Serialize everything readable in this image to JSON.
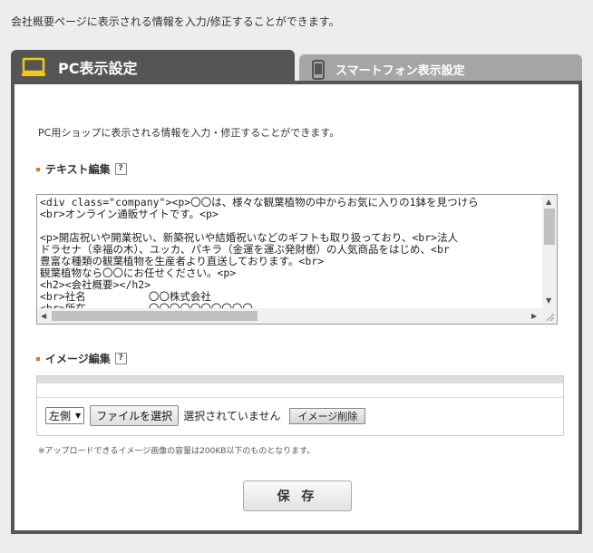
{
  "intro": "会社概要ページに表示される情報を入力/修正することができます。",
  "tabs": {
    "pc": {
      "label": "PC表示設定",
      "icon": "monitor-icon"
    },
    "smartphone": {
      "label": "スマートフォン表示設定",
      "icon": "smartphone-icon"
    }
  },
  "panel": {
    "description": "PC用ショップに表示される情報を入力・修正することができます。",
    "text_section": {
      "title": "テキスト編集",
      "help": "?"
    },
    "editor_content": "<div class=\"company\"><p>〇〇は、様々な観葉植物の中からお気に入りの1鉢を見つけら\n<br>オンライン通販サイトです。<p>\n\n<p>開店祝いや開業祝い、新築祝いや結婚祝いなどのギフトも取り扱っており、<br>法人\nドラセナ（幸福の木）、ユッカ、パキラ（金運を運ぶ発財樹）の人気商品をはじめ、<br\n豊富な種類の観葉植物を生産者より直送しております。<br>\n観葉植物なら〇〇にお任せください。<p>\n<h2><会社概要></h2>\n<br>社名          〇〇株式会社\n<br>所在          〇〇〇〇〇〇〇〇〇〇",
    "image_section": {
      "title": "イメージ編集",
      "help": "?"
    },
    "align_select": "左側",
    "file_button": "ファイルを選択",
    "file_status": "選択されていません",
    "delete_image_button": "イメージ削除",
    "note": "※アップロードできるイメージ画像の容量は200KB以下のものとなります。",
    "save_button": "保 存"
  },
  "colors": {
    "accent": "#e8731a",
    "tab_active": "#555555",
    "tab_inactive": "#a6a6a6",
    "monitor_icon": "#f5c518"
  }
}
